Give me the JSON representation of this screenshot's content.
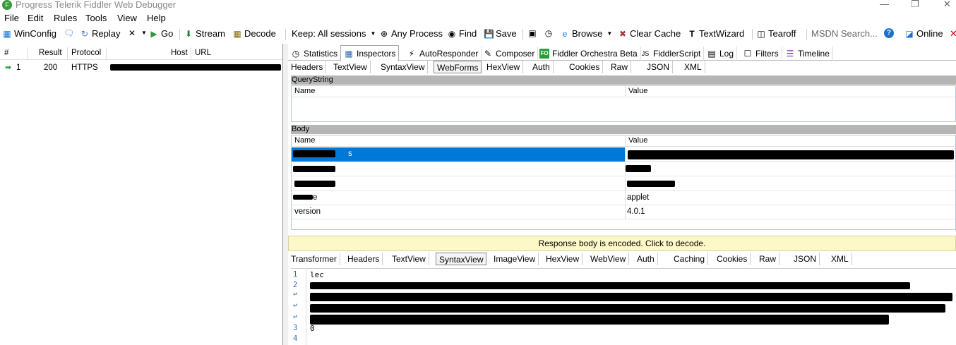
{
  "window": {
    "title": "Progress Telerik Fiddler Web Debugger"
  },
  "menu": [
    "File",
    "Edit",
    "Rules",
    "Tools",
    "View",
    "Help"
  ],
  "toolbar": {
    "winconfig": "WinConfig",
    "replay": "Replay",
    "go": "Go",
    "stream": "Stream",
    "decode": "Decode",
    "keep": "Keep: All sessions",
    "any_process": "Any Process",
    "find": "Find",
    "save": "Save",
    "browse": "Browse",
    "clear_cache": "Clear Cache",
    "textwizard": "TextWizard",
    "tearoff": "Tearoff",
    "search_placeholder": "MSDN Search...",
    "online": "Online"
  },
  "sessions": {
    "columns": [
      "#",
      "Result",
      "Protocol",
      "Host",
      "URL"
    ],
    "rows": [
      {
        "num": "1",
        "result": "200",
        "protocol": "HTTPS"
      }
    ]
  },
  "main_tabs": [
    "Statistics",
    "Inspectors",
    "AutoResponder",
    "Composer",
    "Fiddler Orchestra Beta",
    "FiddlerScript",
    "Log",
    "Filters",
    "Timeline"
  ],
  "request_tabs": [
    "Headers",
    "TextView",
    "SyntaxView",
    "WebForms",
    "HexView",
    "Auth",
    "Cookies",
    "Raw",
    "JSON",
    "XML"
  ],
  "querystring": {
    "title": "QueryString",
    "col_name": "Name",
    "col_value": "Value"
  },
  "body": {
    "title": "Body",
    "col_name": "Name",
    "col_value": "Value",
    "rows": [
      {
        "name_suffix": "s",
        "value": ""
      },
      {
        "name_suffix": "",
        "value": ""
      },
      {
        "name_suffix": "",
        "value": ""
      },
      {
        "name_suffix": "e",
        "value": "applet"
      },
      {
        "name_suffix": "version",
        "value": "4.0.1"
      }
    ]
  },
  "response_notice": "Response body is encoded. Click to decode.",
  "response_tabs": [
    "Transformer",
    "Headers",
    "TextView",
    "SyntaxView",
    "ImageView",
    "HexView",
    "WebView",
    "Auth",
    "Caching",
    "Cookies",
    "Raw",
    "JSON",
    "XML"
  ],
  "code": {
    "line_numbers": [
      "1",
      "2",
      "3",
      "4"
    ],
    "line1": "lec",
    "line3": "0"
  }
}
